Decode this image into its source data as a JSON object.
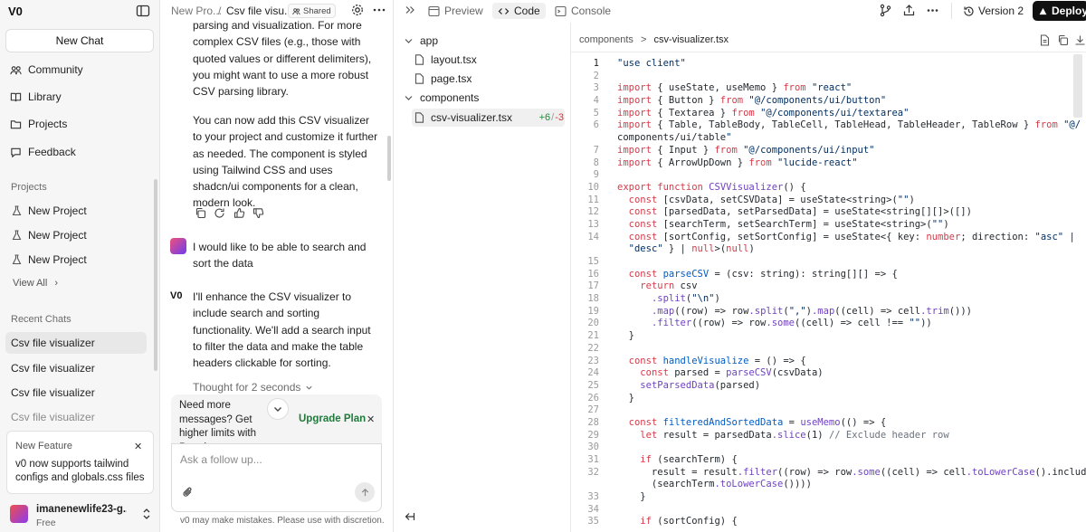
{
  "app": {
    "logo": "V0"
  },
  "sidebar": {
    "new_chat": "New Chat",
    "nav": [
      "Community",
      "Library",
      "Projects",
      "Feedback"
    ],
    "projects_label": "Projects",
    "projects": [
      "New Project",
      "New Project",
      "New Project"
    ],
    "view_all": "View All",
    "recent_label": "Recent Chats",
    "recent": [
      "Csv file visualizer",
      "Csv file visualizer",
      "Csv file visualizer",
      "Csv file visualizer"
    ],
    "feature": {
      "title": "New Feature",
      "body": "v0 now supports tailwind configs and globals.css files"
    },
    "user": {
      "name": "imanenewlife23-g...",
      "plan": "Free"
    }
  },
  "chat": {
    "breadcrumb_project": "New Pro...",
    "breadcrumb_sep": "/",
    "breadcrumb_title": "Csv file visu...",
    "shared": "Shared",
    "assistant_text_1": "parsing and visualization. For more complex CSV files (e.g., those with quoted values or different delimiters), you might want to use a more robust CSV parsing library.",
    "assistant_text_2": "You can now add this CSV visualizer to your project and customize it further as needed. The component is styled using Tailwind CSS and uses shadcn/ui components for a clean, modern look.",
    "user_message": "I would like to be able to search and sort the data",
    "assistant_text_3": "I'll enhance the CSV visualizer to include search and sorting functionality. We'll add a search input to filter the data and make the table headers clickable for sorting.",
    "assistant_logo": "V0",
    "thought": "Thought for 2 seconds",
    "upgrade_text": "Need more messages? Get higher limits with Premium.",
    "upgrade_link": "Upgrade Plan",
    "input_placeholder": "Ask a follow up...",
    "disclaimer": "v0 may make mistakes. Please use with discretion."
  },
  "toolbar": {
    "tabs": [
      "Preview",
      "Code",
      "Console"
    ],
    "version": "Version 2",
    "deploy": "Deploy"
  },
  "files": {
    "folder_app": "app",
    "app_files": [
      "layout.tsx",
      "page.tsx"
    ],
    "folder_components": "components",
    "component_file": "csv-visualizer.tsx",
    "additions": "+6",
    "diff_sep": "/",
    "deletions": "-3"
  },
  "editor": {
    "breadcrumb_folder": "components",
    "breadcrumb_sep": ">",
    "breadcrumb_file": "csv-visualizer.tsx",
    "lines": [
      [
        "1",
        "\"use client\""
      ],
      [
        "2",
        ""
      ],
      [
        "3",
        "import { useState, useMemo } from \"react\""
      ],
      [
        "4",
        "import { Button } from \"@/components/ui/button\""
      ],
      [
        "5",
        "import { Textarea } from \"@/components/ui/textarea\""
      ],
      [
        "6",
        "import { Table, TableBody, TableCell, TableHead, TableHeader, TableRow } from \"@/"
      ],
      [
        "",
        "components/ui/table\""
      ],
      [
        "7",
        "import { Input } from \"@/components/ui/input\""
      ],
      [
        "8",
        "import { ArrowUpDown } from \"lucide-react\""
      ],
      [
        "9",
        ""
      ],
      [
        "10",
        "export function CSVVisualizer() {"
      ],
      [
        "11",
        "  const [csvData, setCSVData] = useState<string>(\"\")"
      ],
      [
        "12",
        "  const [parsedData, setParsedData] = useState<string[][]>([])"
      ],
      [
        "13",
        "  const [searchTerm, setSearchTerm] = useState<string>(\"\")"
      ],
      [
        "14",
        "  const [sortConfig, setSortConfig] = useState<{ key: number; direction: \"asc\" |"
      ],
      [
        "",
        "  \"desc\" } | null>(null)"
      ],
      [
        "15",
        ""
      ],
      [
        "16",
        "  const parseCSV = (csv: string): string[][] => {"
      ],
      [
        "17",
        "    return csv"
      ],
      [
        "18",
        "      .split(\"\\n\")"
      ],
      [
        "19",
        "      .map((row) => row.split(\",\").map((cell) => cell.trim()))"
      ],
      [
        "20",
        "      .filter((row) => row.some((cell) => cell !== \"\"))"
      ],
      [
        "21",
        "  }"
      ],
      [
        "22",
        ""
      ],
      [
        "23",
        "  const handleVisualize = () => {"
      ],
      [
        "24",
        "    const parsed = parseCSV(csvData)"
      ],
      [
        "25",
        "    setParsedData(parsed)"
      ],
      [
        "26",
        "  }"
      ],
      [
        "27",
        ""
      ],
      [
        "28",
        "  const filteredAndSortedData = useMemo(() => {"
      ],
      [
        "29",
        "    let result = parsedData.slice(1) // Exclude header row"
      ],
      [
        "30",
        ""
      ],
      [
        "31",
        "    if (searchTerm) {"
      ],
      [
        "32",
        "      result = result.filter((row) => row.some((cell) => cell.toLowerCase().includes"
      ],
      [
        "",
        "      (searchTerm.toLowerCase())))"
      ],
      [
        "33",
        "    }"
      ],
      [
        "34",
        ""
      ],
      [
        "35",
        "    if (sortConfig) {"
      ]
    ]
  }
}
